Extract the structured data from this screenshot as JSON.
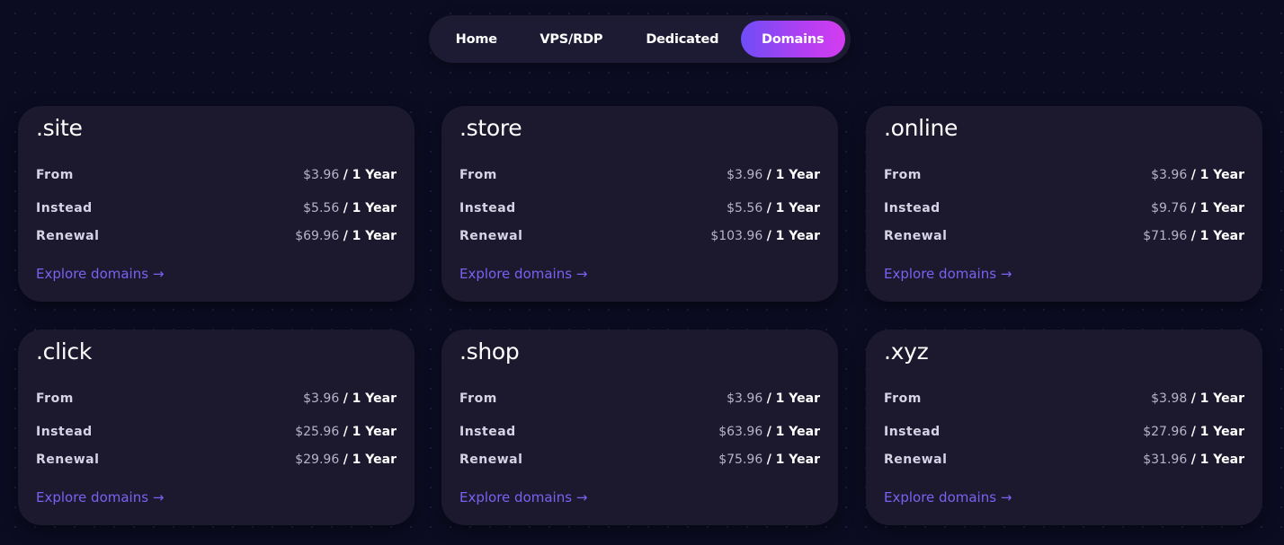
{
  "nav": {
    "items": [
      {
        "label": "Home"
      },
      {
        "label": "VPS/RDP"
      },
      {
        "label": "Dedicated"
      },
      {
        "label": "Domains"
      }
    ],
    "active": "Domains"
  },
  "labels": {
    "from": "From",
    "instead": "Instead",
    "renewal": "Renewal",
    "period": "/ 1 Year",
    "explore": "Explore domains →"
  },
  "cards": [
    {
      "tld": ".site",
      "from": "$3.96",
      "instead": "$5.56",
      "renewal": "$69.96"
    },
    {
      "tld": ".store",
      "from": "$3.96",
      "instead": "$5.56",
      "renewal": "$103.96"
    },
    {
      "tld": ".online",
      "from": "$3.96",
      "instead": "$9.76",
      "renewal": "$71.96"
    },
    {
      "tld": ".click",
      "from": "$3.96",
      "instead": "$25.96",
      "renewal": "$29.96"
    },
    {
      "tld": ".shop",
      "from": "$3.96",
      "instead": "$63.96",
      "renewal": "$75.96"
    },
    {
      "tld": ".xyz",
      "from": "$3.98",
      "instead": "$27.96",
      "renewal": "$31.96"
    }
  ],
  "colors": {
    "background": "#0b0c21",
    "card": "#1c192f",
    "accent_link": "#7b61f0",
    "active_gradient_start": "#6f4df6",
    "active_gradient_end": "#d53cf0"
  }
}
